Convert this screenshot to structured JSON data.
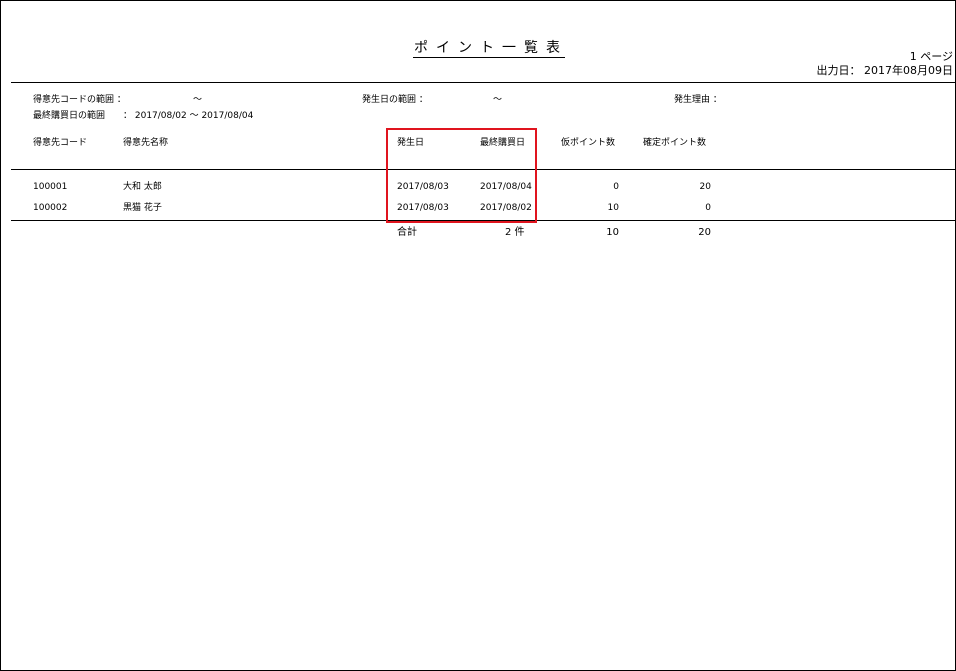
{
  "report": {
    "title": "ポイント一覧表",
    "page_label": "1 ページ",
    "output_date": "出力日： 2017年08月09日"
  },
  "filters": {
    "customer_code_range_label": "得意先コードの範囲 ：",
    "customer_code_range_sep": "～",
    "occurrence_date_range_label": "発生日の範囲 ：",
    "occurrence_date_range_sep": "～",
    "reason_label": "発生理由 ：",
    "last_purchase_range_label": "最終購買日の範囲",
    "last_purchase_range_value": "： 2017/08/02 ～  2017/08/04"
  },
  "table": {
    "headers": {
      "customer_code": "得意先コード",
      "customer_name": "得意先名称",
      "occurrence_date": "発生日",
      "last_purchase_date": "最終購買日",
      "provisional_points": "仮ポイント数",
      "confirmed_points": "確定ポイント数"
    },
    "rows": [
      {
        "code": "100001",
        "name": "大和 太郎",
        "occurrence_date": "2017/08/03",
        "last_purchase_date": "2017/08/04",
        "provisional_points": "0",
        "confirmed_points": "20"
      },
      {
        "code": "100002",
        "name": "黒猫 花子",
        "occurrence_date": "2017/08/03",
        "last_purchase_date": "2017/08/02",
        "provisional_points": "10",
        "confirmed_points": "0"
      }
    ],
    "totals": {
      "label": "合計",
      "count": "2 件",
      "provisional_points": "10",
      "confirmed_points": "20"
    }
  },
  "colors": {
    "highlight": "#e0141e"
  }
}
